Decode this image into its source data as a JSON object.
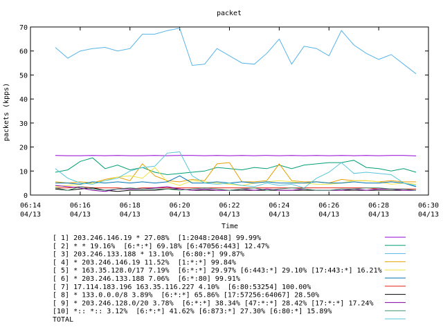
{
  "chart_data": {
    "type": "line",
    "title": "packet",
    "xlabel": "Time",
    "ylabel": "packets (kpps)",
    "ylim": [
      0,
      70
    ],
    "yticks": [
      0,
      10,
      20,
      30,
      40,
      50,
      60,
      70
    ],
    "xlim_minutes": [
      374,
      390
    ],
    "xticks": [
      {
        "minute": 374,
        "time": "06:14",
        "date": "04/13"
      },
      {
        "minute": 376,
        "time": "06:16",
        "date": "04/13"
      },
      {
        "minute": 378,
        "time": "06:18",
        "date": "04/13"
      },
      {
        "minute": 380,
        "time": "06:20",
        "date": "04/13"
      },
      {
        "minute": 382,
        "time": "06:22",
        "date": "04/13"
      },
      {
        "minute": 384,
        "time": "06:24",
        "date": "04/13"
      },
      {
        "minute": 386,
        "time": "06:26",
        "date": "04/13"
      },
      {
        "minute": 388,
        "time": "06:28",
        "date": "04/13"
      },
      {
        "minute": 390,
        "time": "06:30",
        "date": "04/13"
      }
    ],
    "x_minutes": [
      375.0,
      375.5,
      376.0,
      376.5,
      377.0,
      377.5,
      378.0,
      378.5,
      379.0,
      379.5,
      380.0,
      380.5,
      381.0,
      381.5,
      382.0,
      382.5,
      383.0,
      383.5,
      384.0,
      384.5,
      385.0,
      385.5,
      386.0,
      386.5,
      387.0,
      387.5,
      388.0,
      388.5,
      389.0,
      389.5
    ],
    "legend_position": "below",
    "series": [
      {
        "name": "[ 1] 203.246.146.19 * 27.08%  [1:2048:2048] 99.99%",
        "color": "#9400d3",
        "values": [
          16.5,
          16.4,
          16.4,
          16.5,
          16.4,
          16.5,
          16.4,
          16.4,
          16.5,
          16.4,
          16.5,
          16.5,
          16.4,
          16.5,
          16.4,
          16.5,
          16.4,
          16.5,
          16.4,
          16.5,
          16.4,
          16.5,
          16.4,
          16.5,
          16.4,
          16.5,
          16.4,
          16.5,
          16.5,
          16.3
        ]
      },
      {
        "name": "[ 2] * * 19.16%  [6:*:*] 69.18% [6:47056:443] 12.47%",
        "color": "#009e73",
        "values": [
          9.5,
          10.5,
          14.0,
          15.5,
          11.0,
          12.5,
          10.5,
          11.5,
          9.5,
          8.5,
          9.0,
          9.5,
          10.0,
          11.5,
          11.0,
          10.5,
          11.5,
          11.0,
          12.5,
          11.0,
          12.5,
          13.0,
          13.5,
          13.5,
          14.5,
          11.5,
          11.0,
          10.0,
          11.0,
          9.5
        ]
      },
      {
        "name": "[ 3] 203.246.133.188 * 13.10%  [6:80:*] 99.87%",
        "color": "#56b4e9",
        "values": [
          61.5,
          57.0,
          60.0,
          61.0,
          61.5,
          60.0,
          61.0,
          67.0,
          67.0,
          68.5,
          69.5,
          54.0,
          54.5,
          61.0,
          58.0,
          55.0,
          54.5,
          59.0,
          65.0,
          54.5,
          62.0,
          61.0,
          58.0,
          68.5,
          62.5,
          59.0,
          56.5,
          58.5,
          54.5,
          50.5
        ]
      },
      {
        "name": "[ 4] * 203.246.146.19 11.52%  [1:*:*] 99.84%",
        "color": "#e69f00",
        "values": [
          5.5,
          5.0,
          5.5,
          5.0,
          6.5,
          7.5,
          6.0,
          13.0,
          8.0,
          6.0,
          5.5,
          6.5,
          6.0,
          13.0,
          13.5,
          5.5,
          5.5,
          6.0,
          13.0,
          6.0,
          5.5,
          5.5,
          5.0,
          6.5,
          6.0,
          6.0,
          5.5,
          6.0,
          5.5,
          5.5
        ]
      },
      {
        "name": "[ 5] * 163.35.128.0/17 7.19%  [6:*:*] 29.97% [6:443:*] 29.10% [17:443:*] 16.21%",
        "color": "#f0e442",
        "values": [
          3.5,
          4.0,
          4.5,
          5.0,
          6.0,
          7.5,
          8.0,
          7.0,
          11.5,
          5.5,
          4.0,
          6.0,
          5.5,
          5.0,
          4.5,
          4.0,
          5.0,
          5.5,
          6.0,
          5.5,
          5.0,
          4.5,
          4.5,
          5.0,
          6.0,
          6.0,
          5.5,
          4.5,
          5.0,
          4.5
        ]
      },
      {
        "name": "[ 6] * 203.246.133.188 7.06%  [6:*:80] 99.91%",
        "color": "#0072b2",
        "values": [
          5.0,
          5.0,
          4.5,
          5.5,
          5.0,
          5.5,
          5.0,
          5.5,
          5.0,
          5.5,
          8.0,
          5.0,
          5.0,
          5.5,
          5.0,
          5.5,
          5.0,
          5.5,
          5.0,
          5.0,
          5.0,
          5.5,
          5.0,
          5.0,
          5.5,
          5.0,
          5.0,
          5.5,
          5.0,
          3.5
        ]
      },
      {
        "name": "[ 7] 17.114.183.196 163.35.116.227 4.10%  [6:80:53254] 100.00%",
        "color": "#e51e10",
        "values": [
          3.0,
          3.0,
          3.5,
          3.0,
          3.0,
          3.0,
          2.5,
          3.0,
          3.0,
          3.0,
          3.0,
          3.0,
          3.0,
          3.0,
          3.0,
          3.0,
          3.0,
          3.0,
          3.0,
          3.0,
          3.0,
          3.0,
          3.0,
          3.0,
          3.0,
          3.0,
          2.5,
          2.5,
          2.5,
          2.5
        ]
      },
      {
        "name": "[ 8] * 133.0.0.0/8 3.89%  [6:*:*] 65.86% [17:57256:64067] 28.50%",
        "color": "#000000",
        "values": [
          2.5,
          2.0,
          2.5,
          3.0,
          2.0,
          1.5,
          2.0,
          2.0,
          2.0,
          2.5,
          2.5,
          2.0,
          2.0,
          2.0,
          2.0,
          2.0,
          2.0,
          2.0,
          2.0,
          2.0,
          2.0,
          2.0,
          2.0,
          2.0,
          2.0,
          2.0,
          2.0,
          2.0,
          2.0,
          2.0
        ]
      },
      {
        "name": "[ 9] * 203.246.128.0/20 3.78%  [6:*:*] 38.34% [47:*:*] 28.42% [17:*:*] 17.24%",
        "color": "#8000a0",
        "values": [
          4.0,
          3.5,
          3.0,
          2.0,
          1.5,
          2.5,
          2.5,
          2.5,
          3.0,
          3.5,
          2.5,
          2.0,
          2.5,
          2.0,
          2.0,
          2.5,
          2.0,
          2.5,
          2.0,
          2.0,
          2.5,
          2.0,
          2.0,
          2.0,
          2.5,
          2.0,
          2.5,
          2.5,
          2.0,
          2.0
        ]
      },
      {
        "name": "[10] *:: *:: 3.12%  [6:*:*] 41.62% [6:873:*] 27.30% [6:80:*] 15.89%",
        "color": "#3f8f6f",
        "values": [
          3.0,
          2.0,
          3.5,
          2.5,
          2.0,
          2.5,
          3.0,
          2.5,
          2.5,
          2.5,
          2.0,
          2.5,
          3.0,
          2.5,
          2.0,
          2.5,
          3.0,
          2.0,
          2.5,
          3.0,
          2.5,
          2.0,
          2.0,
          2.5,
          2.5,
          3.0,
          3.0,
          2.5,
          2.5,
          2.0
        ]
      },
      {
        "name": "TOTAL",
        "color": "#56c6d8",
        "values": [
          11.0,
          7.0,
          5.0,
          4.5,
          6.0,
          7.0,
          10.0,
          11.5,
          12.0,
          17.5,
          18.0,
          8.0,
          5.0,
          4.5,
          5.0,
          4.0,
          3.5,
          5.0,
          4.0,
          4.5,
          3.0,
          7.0,
          9.5,
          13.5,
          9.0,
          9.5,
          9.0,
          8.5,
          5.0,
          4.0
        ]
      }
    ]
  }
}
